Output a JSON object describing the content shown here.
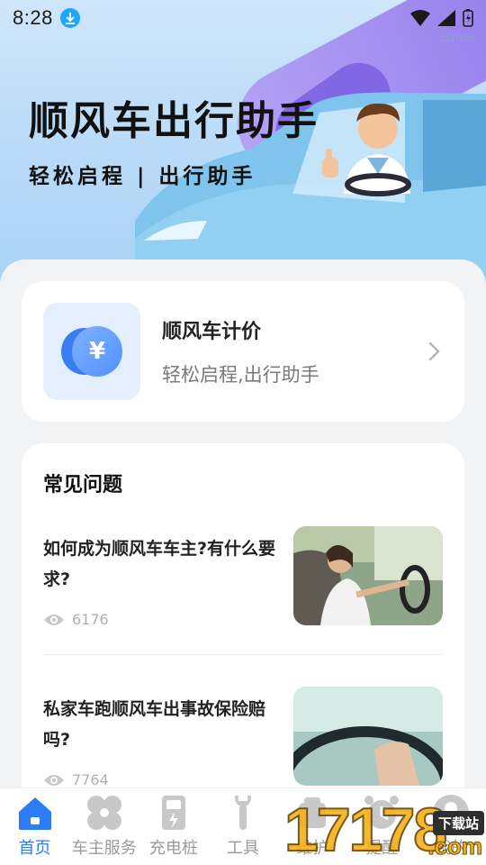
{
  "status_bar": {
    "time": "8:28",
    "build_tag": "2527f523"
  },
  "hero": {
    "title": "顺风车出行助手",
    "subtitle": "轻松启程 | 出行助手"
  },
  "pricing_card": {
    "icon": "yuan-coin-icon",
    "title": "顺风车计价",
    "description": "轻松启程,出行助手"
  },
  "faq": {
    "heading": "常见问题",
    "items": [
      {
        "question": "如何成为顺风车车主?有什么要求?",
        "views": "6176",
        "thumb": "driver-photo"
      },
      {
        "question": "私家车跑顺风车出事故保险赔吗?",
        "views": "7764",
        "thumb": "steering-wheel-photo"
      }
    ]
  },
  "bottom_nav": {
    "items": [
      {
        "label": "首页",
        "icon": "home-icon",
        "active": true
      },
      {
        "label": "车主服务",
        "icon": "flower-icon",
        "active": false
      },
      {
        "label": "充电桩",
        "icon": "charging-pile-icon",
        "active": false
      },
      {
        "label": "工具",
        "icon": "wrench-icon",
        "active": false
      },
      {
        "label": "维护",
        "icon": "car-maintenance-icon",
        "active": false
      },
      {
        "label": "提醒",
        "icon": "alarm-clock-icon",
        "active": false
      },
      {
        "label": "我的",
        "icon": "profile-icon",
        "active": false
      }
    ],
    "active_color": "#2b7cf6",
    "inactive_color": "#9a9a9a"
  },
  "watermark": {
    "digits": "17178",
    "badge": "下载站",
    "suffix": ".com"
  }
}
